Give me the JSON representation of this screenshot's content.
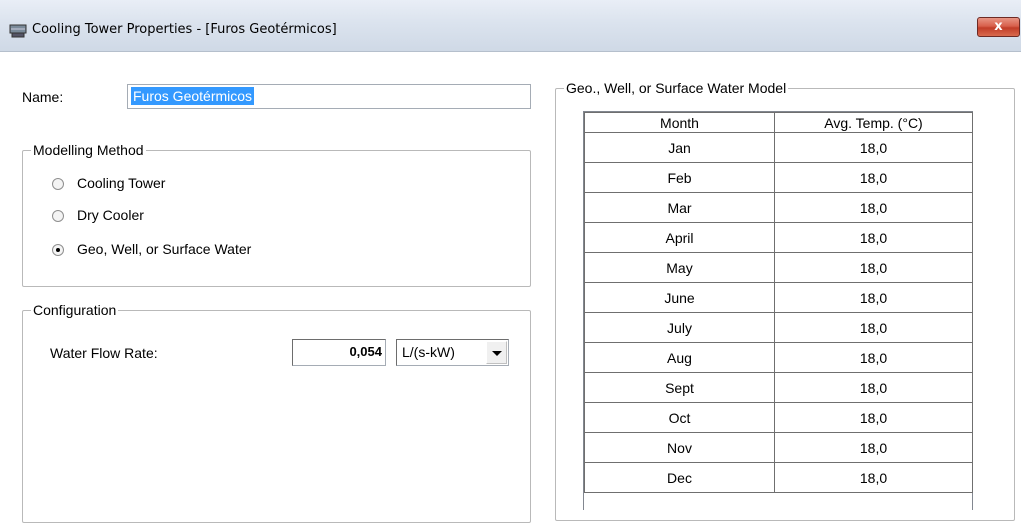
{
  "window": {
    "title": "Cooling Tower Properties - [Furos Geotérmicos]",
    "close_label": "x"
  },
  "name": {
    "label": "Name:",
    "value": "Furos Geotérmicos"
  },
  "modelling": {
    "legend": "Modelling Method",
    "options": [
      {
        "label": "Cooling Tower",
        "checked": false
      },
      {
        "label": "Dry Cooler",
        "checked": false
      },
      {
        "label": "Geo, Well, or Surface Water",
        "checked": true
      }
    ]
  },
  "configuration": {
    "legend": "Configuration",
    "flow_label": "Water Flow Rate:",
    "flow_value": "0,054",
    "unit_value": "L/(s-kW)"
  },
  "geo_model": {
    "legend": "Geo., Well, or Surface Water Model",
    "columns": [
      "Month",
      "Avg. Temp. (°C)"
    ],
    "rows": [
      [
        "Jan",
        "18,0"
      ],
      [
        "Feb",
        "18,0"
      ],
      [
        "Mar",
        "18,0"
      ],
      [
        "April",
        "18,0"
      ],
      [
        "May",
        "18,0"
      ],
      [
        "June",
        "18,0"
      ],
      [
        "July",
        "18,0"
      ],
      [
        "Aug",
        "18,0"
      ],
      [
        "Sept",
        "18,0"
      ],
      [
        "Oct",
        "18,0"
      ],
      [
        "Nov",
        "18,0"
      ],
      [
        "Dec",
        "18,0"
      ]
    ]
  }
}
